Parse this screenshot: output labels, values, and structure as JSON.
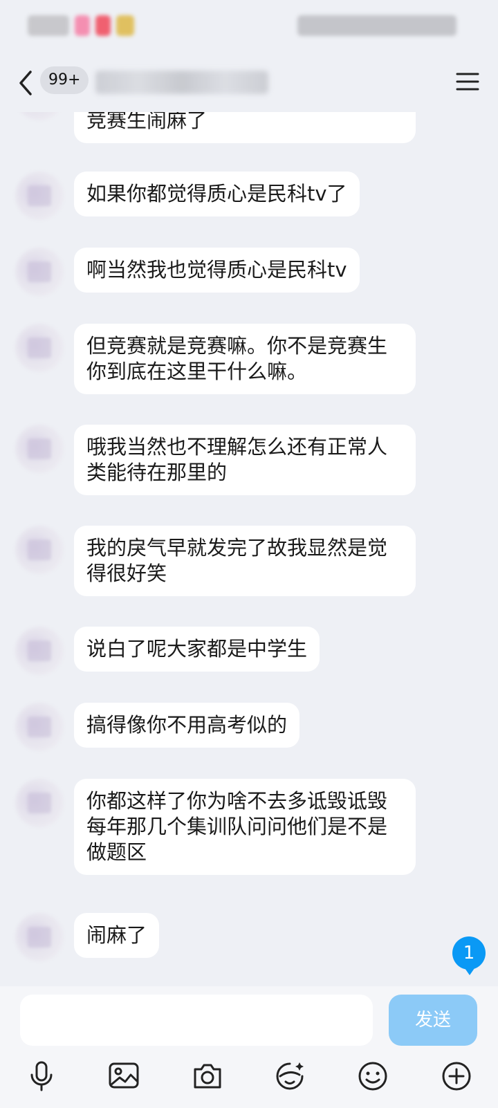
{
  "header": {
    "unread_count": "99+"
  },
  "messages": [
    {
      "text": "竞赛生闹麻了"
    },
    {
      "text": "如果你都觉得质心是民科tv了"
    },
    {
      "text": "啊当然我也觉得质心是民科tv"
    },
    {
      "text": "但竞赛就是竞赛嘛。你不是竞赛生你到底在这里干什么嘛。"
    },
    {
      "text": "哦我当然也不理解怎么还有正常人类能待在那里的"
    },
    {
      "text": "我的戾气早就发完了故我显然是觉得很好笑"
    },
    {
      "text": "说白了呢大家都是中学生"
    },
    {
      "text": "搞得像你不用高考似的"
    },
    {
      "text": "你都这样了你为啥不去多诋毁诋毁每年那几个集训队问问他们是不是做题区"
    },
    {
      "text": "闹麻了"
    }
  ],
  "new_message_badge": "1",
  "input": {
    "value": "",
    "send_label": "发送"
  },
  "toolbar": {
    "icons": [
      "microphone-icon",
      "image-icon",
      "camera-icon",
      "sticker-icon",
      "emoji-icon",
      "plus-icon"
    ]
  },
  "colors": {
    "background": "#eef0f5",
    "bubble": "#ffffff",
    "send_button": "#8ccaf7",
    "badge": "#0a99f5"
  }
}
